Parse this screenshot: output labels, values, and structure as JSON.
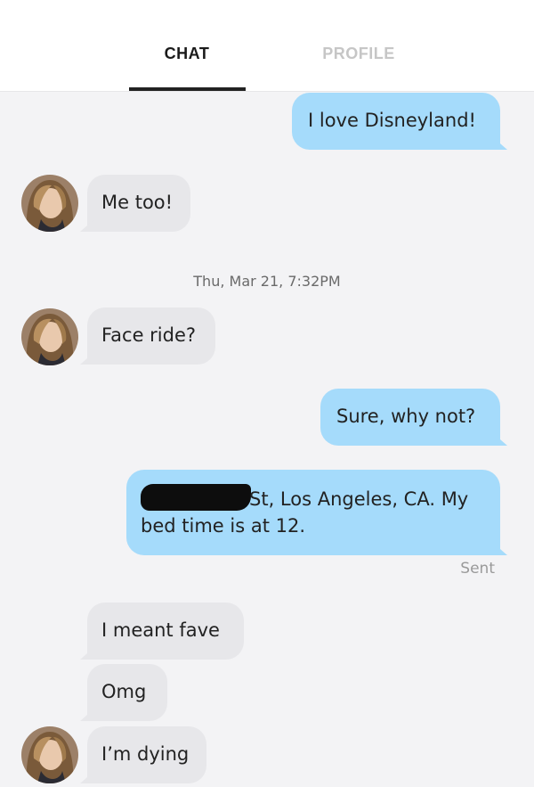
{
  "tabs": {
    "chat": "CHAT",
    "profile": "PROFILE"
  },
  "messages": [
    {
      "text": "I love Disneyland!",
      "direction": "outgoing"
    },
    {
      "text": "Me too!",
      "direction": "incoming"
    },
    {
      "text": "Face ride?",
      "direction": "incoming"
    },
    {
      "text": "Sure, why not?",
      "direction": "outgoing"
    },
    {
      "text_after_redaction": "St, Los Angeles, CA. My",
      "text_line2": "bed time is at 12.",
      "direction": "outgoing"
    },
    {
      "text": "I meant fave",
      "direction": "incoming"
    },
    {
      "text": "Omg",
      "direction": "incoming"
    },
    {
      "text": "I’m dying",
      "direction": "incoming"
    }
  ],
  "timestamp": "Thu, Mar 21, 7:32PM",
  "status": "Sent",
  "colors": {
    "outgoing_bubble": "#a5dbfb",
    "incoming_bubble": "#e7e7ea",
    "background": "#f3f3f5"
  }
}
